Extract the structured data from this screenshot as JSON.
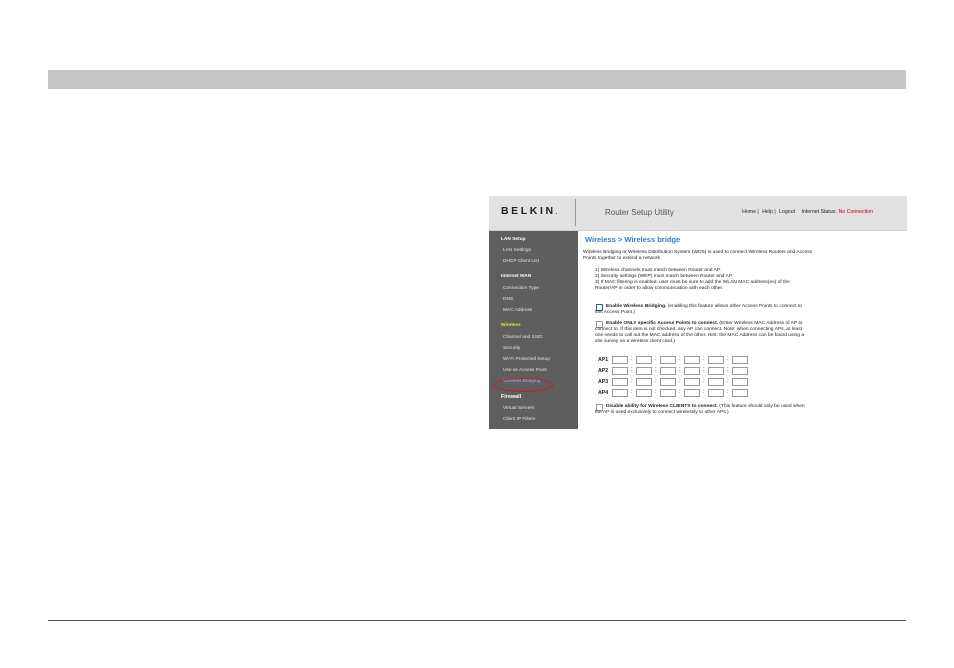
{
  "header": {
    "logo_text": "BELKIN",
    "logo_suffix": ".",
    "app_title": "Router Setup Utility",
    "links": [
      "Home |",
      "Help |",
      "Logout"
    ],
    "status_label": "Internet Status:",
    "status_value": "No Connection",
    "status_color": "#b3001b"
  },
  "sidebar": {
    "lan_setup": "LAN Setup",
    "lan_settings": "LAN Settings",
    "dhcp_client_list": "DHCP Client List",
    "internet_wan": "Internet WAN",
    "connection_type": "Connection Type",
    "dns": "DNS",
    "mac_address": "MAC Address",
    "wireless": "Wireless",
    "channel_ssid": "Channel and SSID",
    "security": "Security",
    "wps": "Wi-Fi Protected Setup",
    "use_as_ap": "Use as Access Point",
    "wireless_bridging": "Wireless Bridging",
    "firewall": "Firewall",
    "virtual_servers": "Virtual Servers",
    "client_ip_filters": "Client IP Filters"
  },
  "content": {
    "title": "Wireless > Wireless bridge",
    "intro_1": "Wireless Bridging or Wireless Distribution System (WDS) is used to connect Wireless Routers and Access",
    "intro_2": "Points together to extend a network.",
    "rule_1": "1) Wireless channels must match between Router and AP.",
    "rule_2": "2) Security settings (WEP) must match between Router and AP.",
    "rule_3a": "3) If MAC filtering is enabled, user must be sure to add the WLAN MAC address(es) of the",
    "rule_3b": "Router/AP in order to allow communication with each other.",
    "enable_bridging_bold": "Enable Wireless Bridging.",
    "enable_bridging_rest": " (enabling this feature allows other Access Points to connect to",
    "enable_bridging_line2": "this Access Point.)",
    "only_specific_bold": "Enable ONLY specific Access Points to connect.",
    "only_specific_rest": " (Enter Wireless MAC Address of AP to",
    "only_specific_line2": "connect to. If this item is not checked, any AP can connect. Note: when connecting APs, at least",
    "only_specific_line3": "one needs to call out the MAC address of the other. Hint: the MAC Address can be found using a",
    "only_specific_line4": "site survey on a wireless client card.)",
    "ap_labels": [
      "AP1",
      "AP2",
      "AP3",
      "AP4"
    ],
    "ap_separator": ":",
    "disable_clients_bold": "Disable ability for Wireless CLIENTS to connect.",
    "disable_clients_rest": " (This feature should only be used when",
    "disable_clients_line2": "the AP is used exclusively to connect wirelessly to other APs.)"
  },
  "colors": {
    "title_blue": "#3a78c4",
    "sidebar_bg": "#5e5e5e",
    "wireless_heading": "#e9e13c",
    "highlight_circle": "#c81e1e"
  }
}
